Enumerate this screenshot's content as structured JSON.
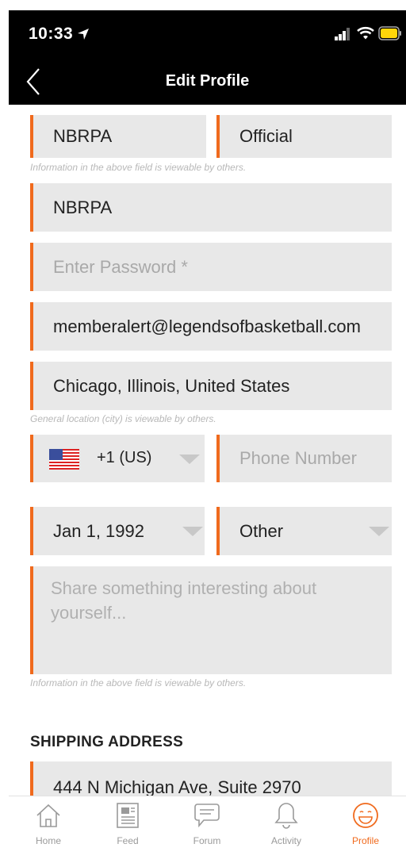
{
  "status_bar": {
    "time": "10:33"
  },
  "header": {
    "title": "Edit Profile"
  },
  "form": {
    "first_name": "NBRPA",
    "last_name": "Official",
    "name_note": "Information in the above field is viewable by others.",
    "username": "NBRPA",
    "password_placeholder": "Enter Password *",
    "email": "memberalert@legendsofbasketball.com",
    "location": "Chicago, Illinois, United States",
    "location_note": "General location (city) is viewable by others.",
    "country_code": "+1 (US)",
    "phone_placeholder": "Phone Number",
    "birthdate": "Jan 1, 1992",
    "gender": "Other",
    "about_placeholder": "Share something interesting about yourself...",
    "about_note": "Information in the above field is viewable by others.",
    "shipping_heading": "SHIPPING ADDRESS",
    "address_line1": "444 N Michigan Ave, Suite 2970"
  },
  "tabs": [
    {
      "label": "Home",
      "icon": "home-icon"
    },
    {
      "label": "Feed",
      "icon": "feed-icon"
    },
    {
      "label": "Forum",
      "icon": "forum-icon"
    },
    {
      "label": "Activity",
      "icon": "bell-icon"
    },
    {
      "label": "Profile",
      "icon": "smiley-icon",
      "active": true
    }
  ],
  "colors": {
    "accent": "#f06a1d",
    "field_bg": "#e8e8e8",
    "header_bg": "#000000"
  }
}
